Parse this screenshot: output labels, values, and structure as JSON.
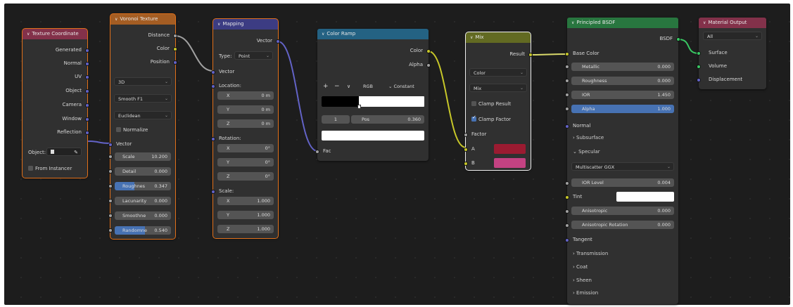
{
  "texture_coordinate": {
    "title": "Texture Coordinate",
    "outputs": [
      "Generated",
      "Normal",
      "UV",
      "Object",
      "Camera",
      "Window",
      "Reflection"
    ],
    "object_label": "Object:",
    "from_instancer": "From Instancer"
  },
  "voronoi": {
    "title": "Voronoi Texture",
    "outputs": [
      "Distance",
      "Color",
      "Position"
    ],
    "dimensions": "3D",
    "feature": "Smooth F1",
    "metric": "Euclidean",
    "normalize": "Normalize",
    "vector_input": "Vector",
    "inputs": [
      {
        "label": "Scale",
        "value": "10.200",
        "fill": 0
      },
      {
        "label": "Detail",
        "value": "0.000",
        "fill": 0
      },
      {
        "label": "Roughnes",
        "value": "0.347",
        "fill": 0.347
      },
      {
        "label": "Lacunarity",
        "value": "0.000",
        "fill": 0
      },
      {
        "label": "Smoothne",
        "value": "0.000",
        "fill": 0
      },
      {
        "label": "Randomne",
        "value": "0.540",
        "fill": 0.54
      }
    ]
  },
  "mapping": {
    "title": "Mapping",
    "output": "Vector",
    "type_label": "Type:",
    "type_value": "Point",
    "vector_input": "Vector",
    "location": {
      "label": "Location:",
      "x": "0 m",
      "y": "0 m",
      "z": "0 m"
    },
    "rotation": {
      "label": "Rotation:",
      "x": "0°",
      "y": "0°",
      "z": "0°"
    },
    "scale": {
      "label": "Scale:",
      "x": "1.000",
      "y": "1.000",
      "z": "1.000"
    },
    "axis": [
      "X",
      "Y",
      "Z"
    ]
  },
  "color_ramp": {
    "title": "Color Ramp",
    "outputs": [
      "Color",
      "Alpha"
    ],
    "plus": "+",
    "minus": "−",
    "menu": "∨",
    "color_mode": "RGB",
    "interpolation": "Constant",
    "index": "1",
    "pos_label": "Pos",
    "pos_value": "0.360",
    "input": "Fac",
    "stop_position": 0.36
  },
  "mix": {
    "title": "Mix",
    "output": "Result",
    "data_type": "Color",
    "blend_mode": "Mix",
    "clamp_result": "Clamp Result",
    "clamp_factor": "Clamp Factor",
    "inputs": [
      "Factor",
      "A",
      "B"
    ],
    "color_a": "#9b1b31",
    "color_b": "#c44282"
  },
  "principled": {
    "title": "Principled BSDF",
    "output": "BSDF",
    "base_color": "Base Color",
    "fields": [
      {
        "label": "Metallic",
        "value": "0.000"
      },
      {
        "label": "Roughness",
        "value": "0.000"
      },
      {
        "label": "IOR",
        "value": "1.450"
      },
      {
        "label": "Alpha",
        "value": "1.000"
      }
    ],
    "normal": "Normal",
    "subsurface": "Subsurface",
    "specular": "Specular",
    "distribution": "Multiscatter GGX",
    "ior_level": {
      "label": "IOR Level",
      "value": "0.004"
    },
    "tint": "Tint",
    "anisotropic": {
      "label": "Anisotropic",
      "value": "0.000"
    },
    "anisotropic_rotation": {
      "label": "Anisotropic Rotation",
      "value": "0.000"
    },
    "tangent": "Tangent",
    "panels": [
      "Transmission",
      "Coat",
      "Sheen",
      "Emission"
    ]
  },
  "material_output": {
    "title": "Material Output",
    "target": "All",
    "inputs": [
      "Surface",
      "Volume",
      "Displacement"
    ]
  },
  "colors": {
    "input_header": "#83314a",
    "texture_header": "#a45d23",
    "vector_header": "#3c3c83",
    "converter_header": "#246283",
    "mix_header": "#626a22",
    "shader_header": "#28763f",
    "output_header": "#83314a",
    "socket_vector": "#6363c7",
    "socket_float": "#a1a1a1",
    "socket_color": "#c7c729",
    "socket_shader": "#39c763"
  }
}
